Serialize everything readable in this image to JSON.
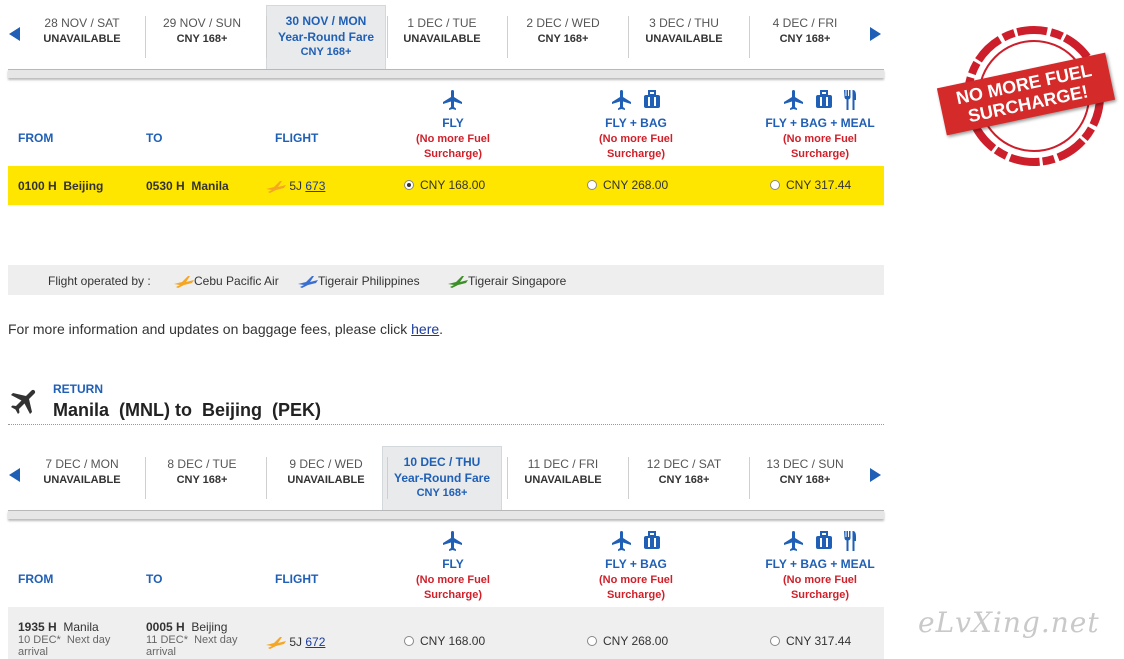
{
  "outbound_dates": [
    {
      "date": "28 NOV / SAT",
      "status": "UNAVAILABLE"
    },
    {
      "date": "29 NOV / SUN",
      "status": "CNY 168+"
    },
    {
      "date": "30 NOV / MON",
      "fare": "Year-Round Fare",
      "status": "CNY 168+",
      "selected": true
    },
    {
      "date": "1 DEC / TUE",
      "status": "UNAVAILABLE"
    },
    {
      "date": "2 DEC / WED",
      "status": "CNY 168+"
    },
    {
      "date": "3 DEC / THU",
      "status": "UNAVAILABLE"
    },
    {
      "date": "4 DEC / FRI",
      "status": "CNY 168+"
    }
  ],
  "return_dates": [
    {
      "date": "7 DEC / MON",
      "status": "UNAVAILABLE"
    },
    {
      "date": "8 DEC / TUE",
      "status": "CNY 168+"
    },
    {
      "date": "9 DEC / WED",
      "status": "UNAVAILABLE"
    },
    {
      "date": "10 DEC / THU",
      "fare": "Year-Round Fare",
      "status": "CNY 168+",
      "selected": true
    },
    {
      "date": "11 DEC / FRI",
      "status": "UNAVAILABLE"
    },
    {
      "date": "12 DEC / SAT",
      "status": "CNY 168+"
    },
    {
      "date": "13 DEC / SUN",
      "status": "CNY 168+"
    }
  ],
  "columns": {
    "from": "FROM",
    "to": "TO",
    "flight": "FLIGHT"
  },
  "fares": [
    {
      "name": "FLY",
      "note1": "(No more Fuel",
      "note2": "Surcharge)",
      "icons": [
        "plane-icon"
      ]
    },
    {
      "name": "FLY + BAG",
      "note1": "(No more Fuel",
      "note2": "Surcharge)",
      "icons": [
        "plane-icon",
        "luggage-icon"
      ]
    },
    {
      "name": "FLY + BAG + MEAL",
      "note1": "(No more Fuel",
      "note2": "Surcharge)",
      "icons": [
        "plane-icon",
        "luggage-icon",
        "meal-icon"
      ]
    }
  ],
  "outbound_flight": {
    "dep_time": "0100 H",
    "dep_city": "Beijing",
    "arr_time": "0530 H",
    "arr_city": "Manila",
    "airline": "5J",
    "number": "673",
    "prices": [
      "CNY 168.00",
      "CNY 268.00",
      "CNY 317.44"
    ]
  },
  "operated": {
    "label": "Flight operated by :",
    "airlines": [
      "Cebu Pacific Air",
      "Tigerair Philippines",
      "Tigerair Singapore"
    ],
    "colors": [
      "#f5a623",
      "#3a6fd0",
      "#3e8e2a"
    ]
  },
  "info": {
    "text": "For more information and updates on baggage fees, please click ",
    "link": "here",
    "end": "."
  },
  "return_section": {
    "label": "RETURN",
    "route": "Manila  (MNL) to  Beijing  (PEK)"
  },
  "return_flight": {
    "dep_time": "1935 H",
    "dep_city": "Manila",
    "dep_date": "10 DEC*",
    "dep_note": "Next day",
    "dep_extra": "arrival",
    "arr_time": "0005 H",
    "arr_city": "Beijing",
    "arr_date": "11 DEC*",
    "arr_note": "Next day",
    "arr_extra": "arrival",
    "airline": "5J",
    "number": "672",
    "prices": [
      "CNY 168.00",
      "CNY 268.00",
      "CNY 317.44"
    ]
  },
  "badge": {
    "line1": "NO MORE FUEL",
    "line2": "SURCHARGE!"
  },
  "watermark": "eLvXing.net",
  "colors": {
    "accent": "#1f5fb5",
    "highlight": "#ffe600",
    "red": "#d0202a"
  }
}
